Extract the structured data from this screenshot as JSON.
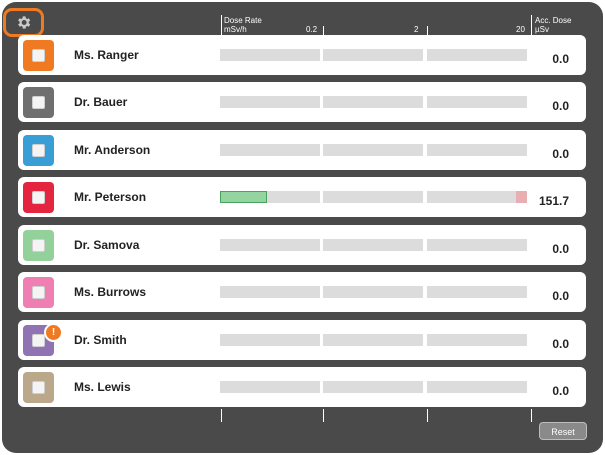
{
  "header": {
    "dose_rate_label": "Dose Rate",
    "dose_rate_unit": "mSv/h",
    "scale_ticks": [
      "0.2",
      "2",
      "20"
    ],
    "acc_dose_label": "Acc. Dose",
    "acc_dose_unit": "µSv"
  },
  "settings_icon": "gear-icon",
  "accent_color": "#f07a22",
  "persons": [
    {
      "name": "Ms. Ranger",
      "color": "#f07a22",
      "acc_dose": "0.0",
      "rate_fill": 0,
      "alert": false
    },
    {
      "name": "Dr. Bauer",
      "color": "#6f6f6f",
      "acc_dose": "0.0",
      "rate_fill": 0,
      "alert": false
    },
    {
      "name": "Mr. Anderson",
      "color": "#3a9ed6",
      "acc_dose": "0.0",
      "rate_fill": 0,
      "alert": false
    },
    {
      "name": "Mr. Peterson",
      "color": "#e5243f",
      "acc_dose": "151.7",
      "rate_fill": 0.47,
      "fill_color": "#93d4a1",
      "peak_marker_color": "#e9aeb2",
      "alert": false
    },
    {
      "name": "Dr. Samova",
      "color": "#93d19a",
      "acc_dose": "0.0",
      "rate_fill": 0,
      "alert": false
    },
    {
      "name": "Ms. Burrows",
      "color": "#ef7fb2",
      "acc_dose": "0.0",
      "rate_fill": 0,
      "alert": false
    },
    {
      "name": "Dr. Smith",
      "color": "#8f73b2",
      "acc_dose": "0.0",
      "rate_fill": 0,
      "alert": true,
      "alert_symbol": "!"
    },
    {
      "name": "Ms. Lewis",
      "color": "#bba88b",
      "acc_dose": "0.0",
      "rate_fill": 0,
      "alert": false
    }
  ],
  "reset_label": "Reset"
}
